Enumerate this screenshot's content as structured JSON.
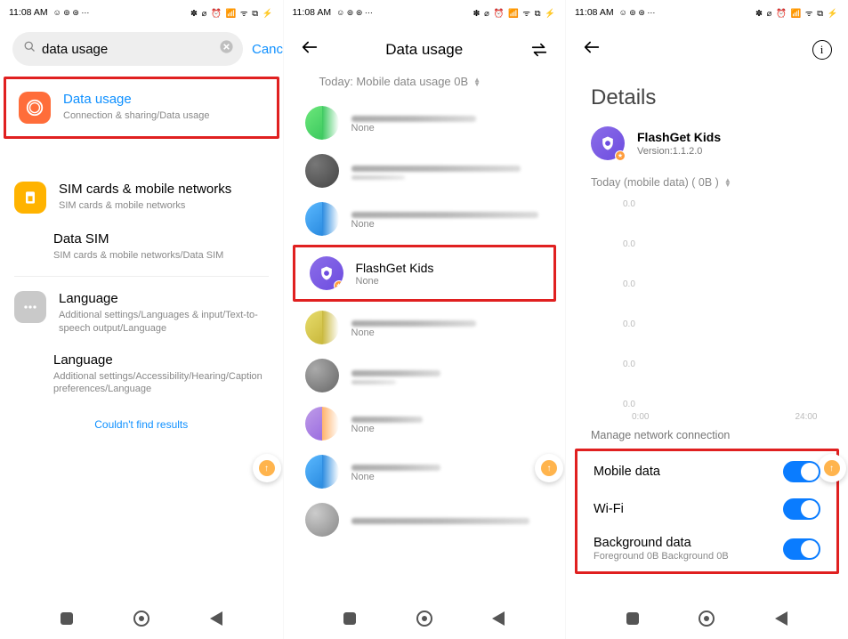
{
  "statusbar": {
    "time": "11:08 AM",
    "left_icons": "☺ ⊚ ⊛ ⋯",
    "right_icons": "✽ ⌀ ⏰ 📶 ᯤ ⧉ ⚡"
  },
  "panel1": {
    "search_value": "data usage",
    "cancel": "Cancel",
    "highlight": {
      "title": "Data usage",
      "path": "Connection & sharing/Data usage"
    },
    "sim": {
      "title": "SIM cards & mobile networks",
      "path": "SIM cards & mobile networks"
    },
    "datasim": {
      "title": "Data SIM",
      "path": "SIM cards & mobile networks/Data SIM"
    },
    "lang1": {
      "title": "Language",
      "path": "Additional settings/Languages & input/Text-to-speech output/Language"
    },
    "lang2": {
      "title": "Language",
      "path": "Additional settings/Accessibility/Hearing/Caption preferences/Language"
    },
    "no_results": "Couldn't find results"
  },
  "panel2": {
    "title": "Data usage",
    "today": "Today: Mobile data usage 0B",
    "app": {
      "name": "FlashGet Kids",
      "usage": "None"
    },
    "none": "None"
  },
  "panel3": {
    "title": "Details",
    "app": {
      "name": "FlashGet Kids",
      "version": "Version:1.1.2.0"
    },
    "filter": "Today (mobile data) ( 0B )",
    "section": "Manage network connection",
    "t1": "Mobile data",
    "t2": "Wi-Fi",
    "t3": {
      "label": "Background data",
      "sub": "Foreground 0B  Background 0B"
    }
  },
  "chart_data": {
    "type": "line",
    "title": "",
    "xlabel": "",
    "ylabel": "",
    "x": [
      "0:00",
      "24:00"
    ],
    "ylim": [
      0,
      0
    ],
    "ytick_label": "0.0",
    "series": [
      {
        "name": "mobile data",
        "values": []
      }
    ]
  }
}
